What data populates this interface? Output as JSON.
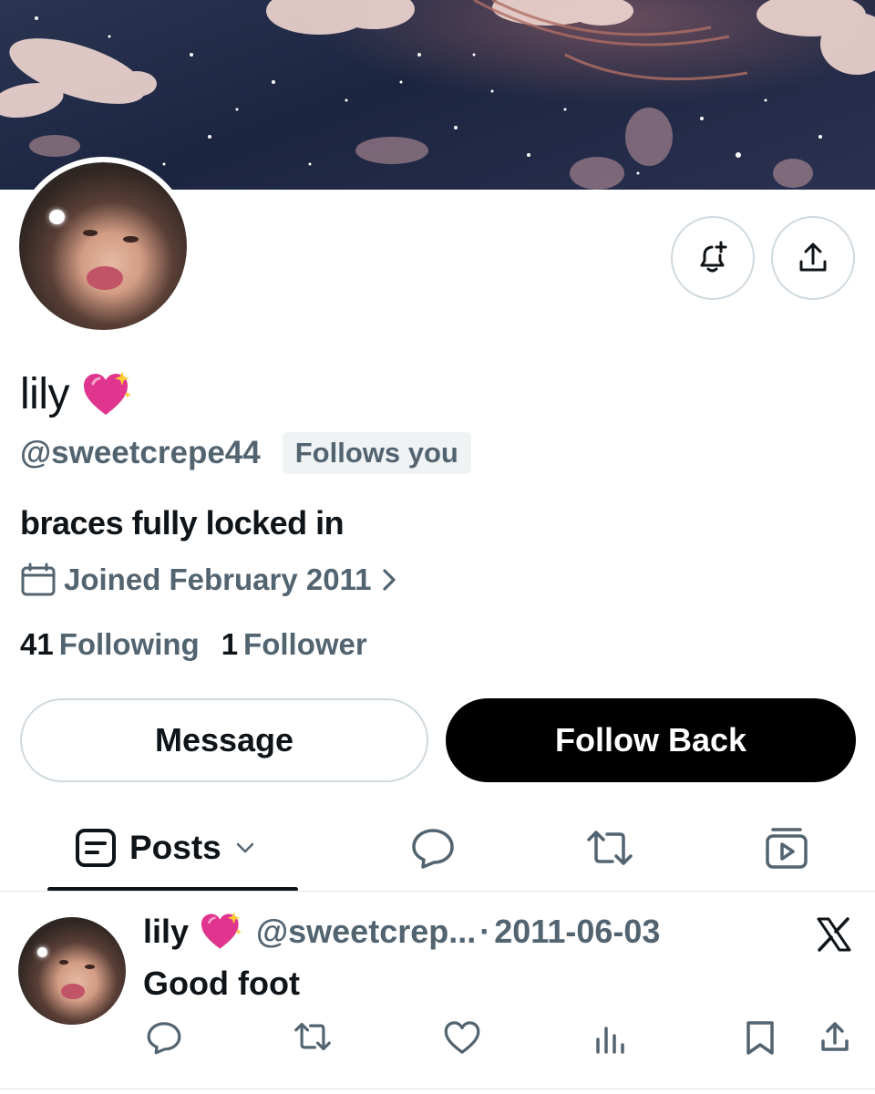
{
  "profile": {
    "display_name": "lily",
    "name_emoji": "sparkling-heart-icon",
    "handle": "@sweetcrepe44",
    "follows_you_badge": "Follows you",
    "bio": "braces fully locked in",
    "joined": "Joined February 2011",
    "following_count": "41",
    "following_label": "Following",
    "followers_count": "1",
    "followers_label": "Follower"
  },
  "actions": {
    "message_label": "Message",
    "follow_back_label": "Follow Back",
    "notify_icon": "bell-plus-icon",
    "share_icon": "share-icon"
  },
  "tabs": {
    "posts_label": "Posts",
    "items": [
      "posts",
      "replies",
      "reposts",
      "media"
    ]
  },
  "post": {
    "name": "lily",
    "handle": "@sweetcrep...",
    "separator": "·",
    "date": "2011-06-03",
    "text": "Good foot",
    "actions": [
      "reply-icon",
      "repost-icon",
      "like-icon",
      "views-icon",
      "bookmark-icon",
      "share-icon"
    ]
  },
  "colors": {
    "text_primary": "#0f1419",
    "text_secondary": "#536471",
    "border": "#cfd9de",
    "follow_button": "#000000",
    "heart_emoji": "#e0358f"
  }
}
